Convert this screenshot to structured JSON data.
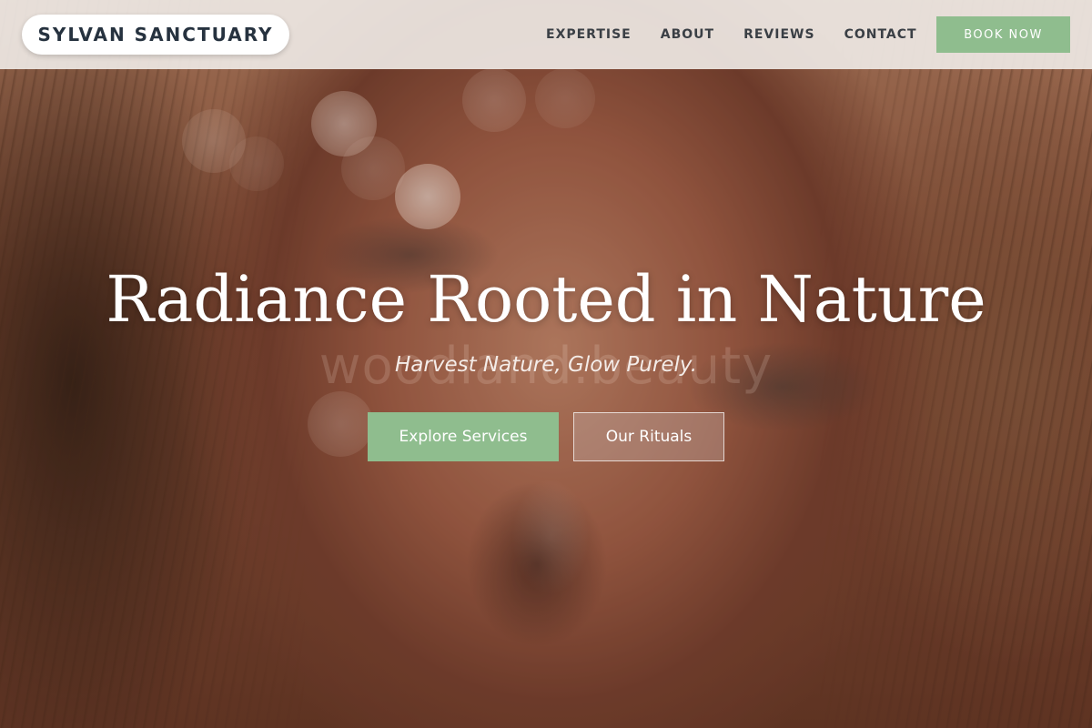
{
  "brand": {
    "logo_text": "SYLVAN SANCTUARY"
  },
  "nav": {
    "items": [
      {
        "label": "EXPERTISE"
      },
      {
        "label": "ABOUT"
      },
      {
        "label": "REVIEWS"
      },
      {
        "label": "CONTACT"
      }
    ],
    "cta_label": "BOOK NOW"
  },
  "hero": {
    "title": "Radiance Rooted in Nature",
    "subtitle": "Harvest Nature, Glow Purely.",
    "watermark": "woodland.beauty",
    "primary_button": "Explore Services",
    "secondary_button": "Our Rituals"
  },
  "colors": {
    "accent_green": "#8fbd8e",
    "header_bg": "#eee8e4",
    "logo_text": "#26323f",
    "nav_text": "#3a3f45"
  }
}
